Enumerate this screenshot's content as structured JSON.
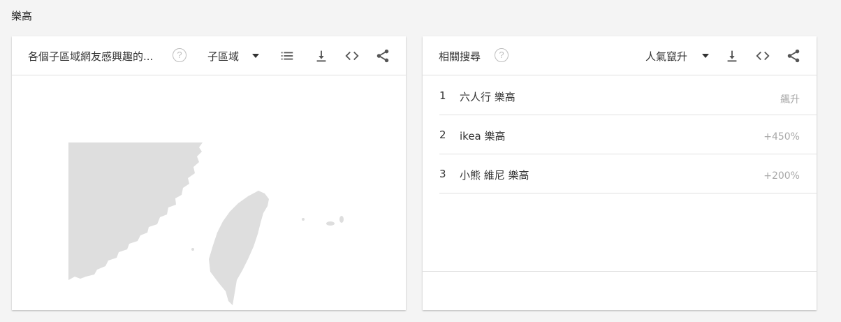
{
  "page": {
    "title": "樂高"
  },
  "left_card": {
    "title": "各個子區域網友感興趣的...",
    "help": "?",
    "dropdown_value": "子區域",
    "icons": [
      "list-icon",
      "download-icon",
      "embed-icon",
      "share-icon"
    ]
  },
  "right_card": {
    "title": "相關搜尋",
    "help": "?",
    "dropdown_value": "人氣竄升",
    "icons": [
      "download-icon",
      "embed-icon",
      "share-icon"
    ],
    "rows": [
      {
        "rank": "1",
        "term": "六人行 樂高",
        "value": "飆升"
      },
      {
        "rank": "2",
        "term": "ikea 樂高",
        "value": "+450%"
      },
      {
        "rank": "3",
        "term": "小熊 維尼 樂高",
        "value": "+200%"
      }
    ]
  },
  "colors": {
    "map_fill": "#dedede",
    "text": "#333333",
    "muted": "#a8a8a8",
    "icon": "#555555"
  }
}
